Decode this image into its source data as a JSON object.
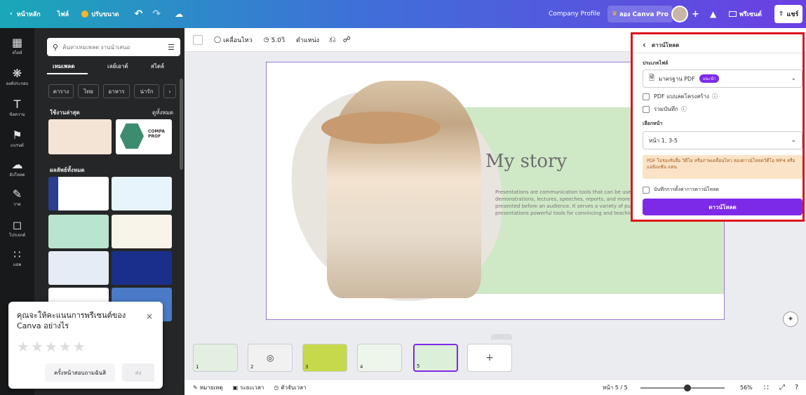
{
  "topbar": {
    "home": "หน้าหลัก",
    "file": "ไฟล์",
    "resize": "ปรับขนาด",
    "doc_title": "Company Profile",
    "try_pro": "ลอง Canva Pro",
    "present": "พรีเซนต์",
    "share": "แชร์"
  },
  "rail": [
    {
      "label": "สไตล์",
      "icon": "layout-icon"
    },
    {
      "label": "องค์ประกอบ",
      "icon": "elements-icon"
    },
    {
      "label": "ข้อความ",
      "icon": "text-icon"
    },
    {
      "label": "แบรนด์",
      "icon": "brand-icon"
    },
    {
      "label": "อัปโหลด",
      "icon": "upload-icon"
    },
    {
      "label": "วาด",
      "icon": "draw-icon"
    },
    {
      "label": "โปรเจกต์",
      "icon": "folder-icon"
    },
    {
      "label": "แอพ",
      "icon": "apps-icon"
    }
  ],
  "panel": {
    "search_placeholder": "ค้นหาเทมเพลต งานนำเสนอ",
    "tabs": [
      "เทมเพลต",
      "เลย์เอาต์",
      "สไตล์"
    ],
    "chips": [
      "ตาราง",
      "ไทย",
      "อาหาร",
      "น่ารัก"
    ],
    "recent_title": "ใช้งานล่าสุด",
    "see_all": "ดูทั้งหมด",
    "all_results": "ผลลัพธ์ทั้งหมด",
    "company_thumb": "COMPA PROF"
  },
  "toolbar": {
    "animate": "เคลื่อนไหว",
    "duration": "5.0วิ",
    "position": "ตำแหน่ง"
  },
  "slide": {
    "title": "My story",
    "body": "Presentations are communication tools that can be used as demonstrations, lectures, speeches, reports, and more. It is mostly presented before an audience. It serves a variety of purposes, making presentations powerful tools for convincing and teaching."
  },
  "download": {
    "back_title": "ดาวน์โหลด",
    "file_type_label": "ประเภทไฟล์",
    "file_type_value": "มาตรฐาน PDF",
    "recommended_badge": "แนะนำ",
    "flatten_pdf": "PDF แบบลดโครงสร้าง",
    "include_notes": "รวมบันทึก",
    "select_pages_label": "เลือกหน้า",
    "pages_value": "หน้า 1, 3-5",
    "warning": "PDF ไม่รองรับสื่อ วิดีโอ หรือภาพเคลื่อนไหว ลองดาวน์โหลดวิดีโอ MP4 หรือ แอนิเมชั่น แทน",
    "save_settings": "บันทึกการตั้งค่าการดาวน์โหลด",
    "download_button": "ดาวน์โหลด",
    "flatten_checked": false,
    "notes_checked": false,
    "save_checked": false
  },
  "rating_popup": {
    "question": "คุณจะให้คะแนนการพรีเซนต์ของ Canva อย่างไร",
    "stars": 0,
    "remind_later": "ครั้งหน้าสอบถามฉันสิ",
    "send": "ส่ง"
  },
  "slides_strip": {
    "numbers": [
      "1",
      "2",
      "3",
      "4",
      "5"
    ],
    "add": "+"
  },
  "statusbar": {
    "notes": "หมายเหตุ",
    "duration": "ระยะเวลา",
    "timer": "ตัวจับเวลา",
    "page_indicator": "หน้า 5 / 5",
    "zoom": "56%",
    "zoom_level": 0.56
  },
  "colors": {
    "accent": "#7d2ae8",
    "highlight_border": "#e1141c",
    "slide_green": "#cfe8c6"
  }
}
